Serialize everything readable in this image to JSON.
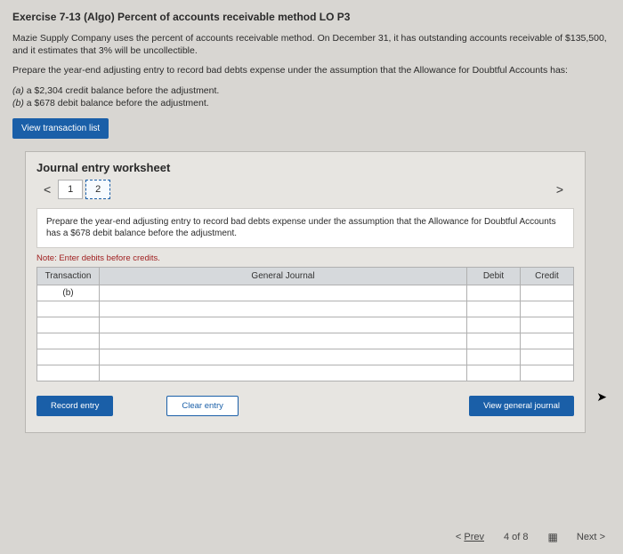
{
  "title": "Exercise 7-13 (Algo) Percent of accounts receivable method LO P3",
  "problem": {
    "p1": "Mazie Supply Company uses the percent of accounts receivable method. On December 31, it has outstanding accounts receivable of $135,500, and it estimates that 3% will be uncollectible.",
    "p2": "Prepare the year-end adjusting entry to record bad debts expense under the assumption that the Allowance for Doubtful Accounts has:",
    "a_label": "(a)",
    "a_text": " a $2,304 credit balance before the adjustment.",
    "b_label": "(b)",
    "b_text": " a $678 debit balance before the adjustment."
  },
  "buttons": {
    "view_list": "View transaction list",
    "record": "Record entry",
    "clear": "Clear entry",
    "view_journal": "View general journal"
  },
  "worksheet": {
    "title": "Journal entry worksheet",
    "steps": [
      "1",
      "2"
    ],
    "chev_left": "<",
    "chev_right": ">",
    "instruction": "Prepare the year-end adjusting entry to record bad debts expense under the assumption that the Allowance for Doubtful Accounts has a $678 debit balance before the adjustment.",
    "note": "Note: Enter debits before credits.",
    "headers": {
      "trans": "Transaction",
      "gen": "General Journal",
      "debit": "Debit",
      "credit": "Credit"
    },
    "row0": {
      "trans": "(b)"
    }
  },
  "footer": {
    "prev_sym": "<",
    "prev": "Prev",
    "pos": "4 of 8",
    "next": "Next",
    "next_sym": ">"
  }
}
